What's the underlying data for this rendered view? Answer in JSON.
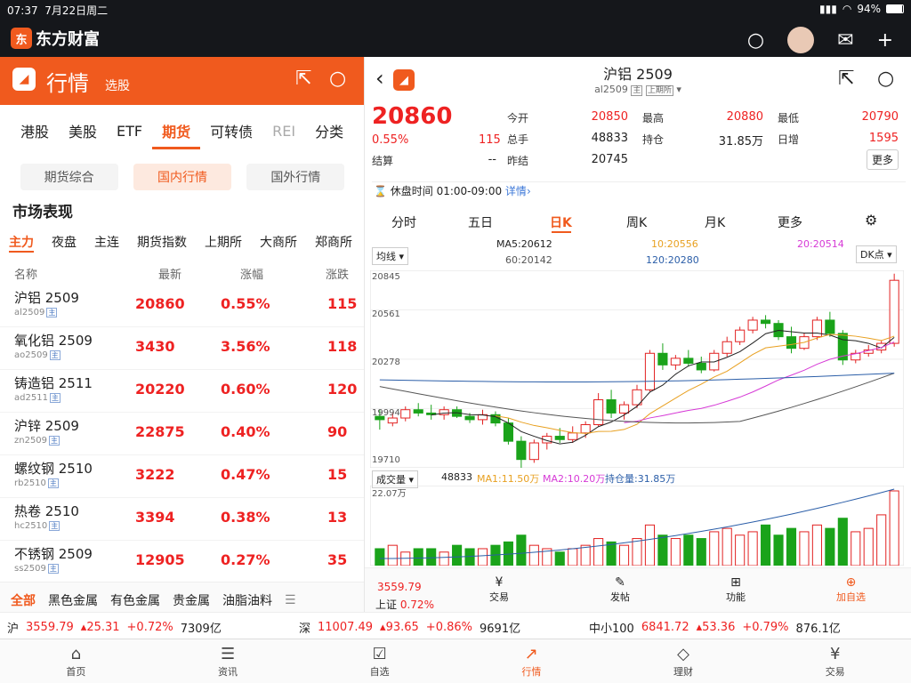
{
  "status": {
    "time": "07:37",
    "date": "7月22日周二",
    "battery": "94%"
  },
  "app": {
    "brand": "东方财富",
    "logo_char": "东"
  },
  "left": {
    "title": "行情",
    "subtitle": "选股",
    "market_tabs": [
      "港股",
      "美股",
      "ETF",
      "期货",
      "可转债",
      "REI",
      "分类"
    ],
    "segments": [
      "期货综合",
      "国内行情",
      "国外行情"
    ],
    "section": "市场表现",
    "sub_tabs": [
      "主力",
      "夜盘",
      "主连",
      "期货指数",
      "上期所",
      "大商所",
      "郑商所"
    ],
    "columns": [
      "名称",
      "最新",
      "涨幅",
      "涨跌"
    ],
    "rows": [
      {
        "name": "沪铝 2509",
        "code": "al2509",
        "tag": "主",
        "last": "20860",
        "pct": "0.55%",
        "chg": "115"
      },
      {
        "name": "氧化铝 2509",
        "code": "ao2509",
        "tag": "主",
        "last": "3430",
        "pct": "3.56%",
        "chg": "118"
      },
      {
        "name": "铸造铝 2511",
        "code": "ad2511",
        "tag": "主",
        "last": "20220",
        "pct": "0.60%",
        "chg": "120"
      },
      {
        "name": "沪锌 2509",
        "code": "zn2509",
        "tag": "主",
        "last": "22875",
        "pct": "0.40%",
        "chg": "90"
      },
      {
        "name": "螺纹钢 2510",
        "code": "rb2510",
        "tag": "主",
        "last": "3222",
        "pct": "0.47%",
        "chg": "15"
      },
      {
        "name": "热卷 2510",
        "code": "hc2510",
        "tag": "主",
        "last": "3394",
        "pct": "0.38%",
        "chg": "13"
      },
      {
        "name": "不锈钢 2509",
        "code": "ss2509",
        "tag": "主",
        "last": "12905",
        "pct": "0.27%",
        "chg": "35"
      }
    ],
    "categories": [
      "全部",
      "黑色金属",
      "有色金属",
      "贵金属",
      "油脂油料"
    ]
  },
  "right": {
    "title": "沪铝 2509",
    "code": "al2509",
    "tag1": "主",
    "tag2": "上期所",
    "price": "20860",
    "pct": "0.55%",
    "chg": "115",
    "quote": [
      {
        "l": "今开",
        "v": "20850"
      },
      {
        "l": "最高",
        "v": "20880"
      },
      {
        "l": "最低",
        "v": "20790"
      },
      {
        "l": "总手",
        "v": "48833"
      },
      {
        "l": "持仓",
        "v": "31.85万"
      },
      {
        "l": "日增",
        "v": "1595"
      },
      {
        "l": "结算",
        "v": "--"
      },
      {
        "l": "昨结",
        "v": "20745"
      }
    ],
    "more": "更多",
    "break_time": "休盘时间 01:00-09:00",
    "detail": "详情",
    "period_tabs": [
      "分时",
      "五日",
      "日K",
      "周K",
      "月K",
      "更多"
    ],
    "ma_select": "均线",
    "dk": "DK点",
    "ma": {
      "ma5": "MA5:20612",
      "ma10": "10:20556",
      "ma20": "20:20514",
      "ma60": "60:20142",
      "ma120": "120:20280"
    },
    "yticks": [
      "20845",
      "20561",
      "20278",
      "19994",
      "19710"
    ],
    "vol_select": "成交量",
    "vol": "48833",
    "vma1": "MA1:11.50万",
    "vma2": "MA2:10.20万",
    "oi": "持仓量:31.85万",
    "vol_max": "22.07万",
    "bottom": {
      "idx_val": "3559.79",
      "idx_name": "上证",
      "idx_pct": "0.72%",
      "items": [
        "交易",
        "发帖",
        "功能",
        "加自选"
      ]
    }
  },
  "indices": [
    {
      "n": "沪",
      "v": "3559.79",
      "c": "25.31",
      "p": "+0.72%",
      "a": "7309亿"
    },
    {
      "n": "深",
      "v": "11007.49",
      "c": "93.65",
      "p": "+0.86%",
      "a": "9691亿"
    },
    {
      "n": "中小100",
      "v": "6841.72",
      "c": "53.36",
      "p": "+0.79%",
      "a": "876.1亿"
    }
  ],
  "nav": [
    "首页",
    "资讯",
    "自选",
    "行情",
    "理财",
    "交易"
  ],
  "colors": {
    "accent": "#f05a1e",
    "up": "#e22222",
    "down": "#1aa31a"
  },
  "chart_data": {
    "type": "candlestick",
    "ylim": [
      19710,
      20900
    ],
    "candles": [
      [
        20020,
        20060,
        19940,
        20000
      ],
      [
        19980,
        20040,
        19960,
        20010
      ],
      [
        20010,
        20080,
        19990,
        20060
      ],
      [
        20060,
        20100,
        20020,
        20040
      ],
      [
        20040,
        20090,
        20000,
        20030
      ],
      [
        20030,
        20080,
        20000,
        20060
      ],
      [
        20060,
        20080,
        20010,
        20020
      ],
      [
        20020,
        20040,
        19980,
        20000
      ],
      [
        20000,
        20060,
        19970,
        20030
      ],
      [
        20030,
        20050,
        19960,
        19980
      ],
      [
        19980,
        20010,
        19850,
        19870
      ],
      [
        19870,
        19900,
        19700,
        19760
      ],
      [
        19760,
        19880,
        19740,
        19860
      ],
      [
        19860,
        19920,
        19820,
        19900
      ],
      [
        19900,
        19950,
        19860,
        19880
      ],
      [
        19880,
        19960,
        19860,
        19920
      ],
      [
        19920,
        19990,
        19890,
        19970
      ],
      [
        19970,
        20160,
        19960,
        20120
      ],
      [
        20120,
        20180,
        20010,
        20040
      ],
      [
        20040,
        20110,
        20000,
        20090
      ],
      [
        20090,
        20210,
        20070,
        20180
      ],
      [
        20180,
        20420,
        20170,
        20400
      ],
      [
        20400,
        20460,
        20300,
        20330
      ],
      [
        20330,
        20390,
        20300,
        20370
      ],
      [
        20370,
        20420,
        20320,
        20340
      ],
      [
        20340,
        20380,
        20280,
        20300
      ],
      [
        20300,
        20420,
        20290,
        20400
      ],
      [
        20400,
        20500,
        20380,
        20470
      ],
      [
        20470,
        20560,
        20450,
        20540
      ],
      [
        20540,
        20620,
        20520,
        20600
      ],
      [
        20600,
        20630,
        20550,
        20580
      ],
      [
        20580,
        20600,
        20480,
        20500
      ],
      [
        20500,
        20560,
        20400,
        20430
      ],
      [
        20430,
        20520,
        20420,
        20500
      ],
      [
        20500,
        20620,
        20480,
        20600
      ],
      [
        20600,
        20650,
        20500,
        20520
      ],
      [
        20520,
        20540,
        20330,
        20360
      ],
      [
        20360,
        20420,
        20340,
        20400
      ],
      [
        20400,
        20450,
        20380,
        20420
      ],
      [
        20420,
        20480,
        20400,
        20460
      ],
      [
        20460,
        20880,
        20440,
        20840
      ]
    ],
    "volumes": [
      5,
      6,
      4,
      5,
      5,
      4,
      6,
      5,
      5,
      6,
      7,
      9,
      6,
      5,
      4,
      5,
      6,
      8,
      7,
      6,
      8,
      12,
      9,
      8,
      9,
      8,
      10,
      11,
      9,
      10,
      12,
      9,
      11,
      10,
      12,
      11,
      14,
      10,
      11,
      15,
      22.07
    ]
  }
}
